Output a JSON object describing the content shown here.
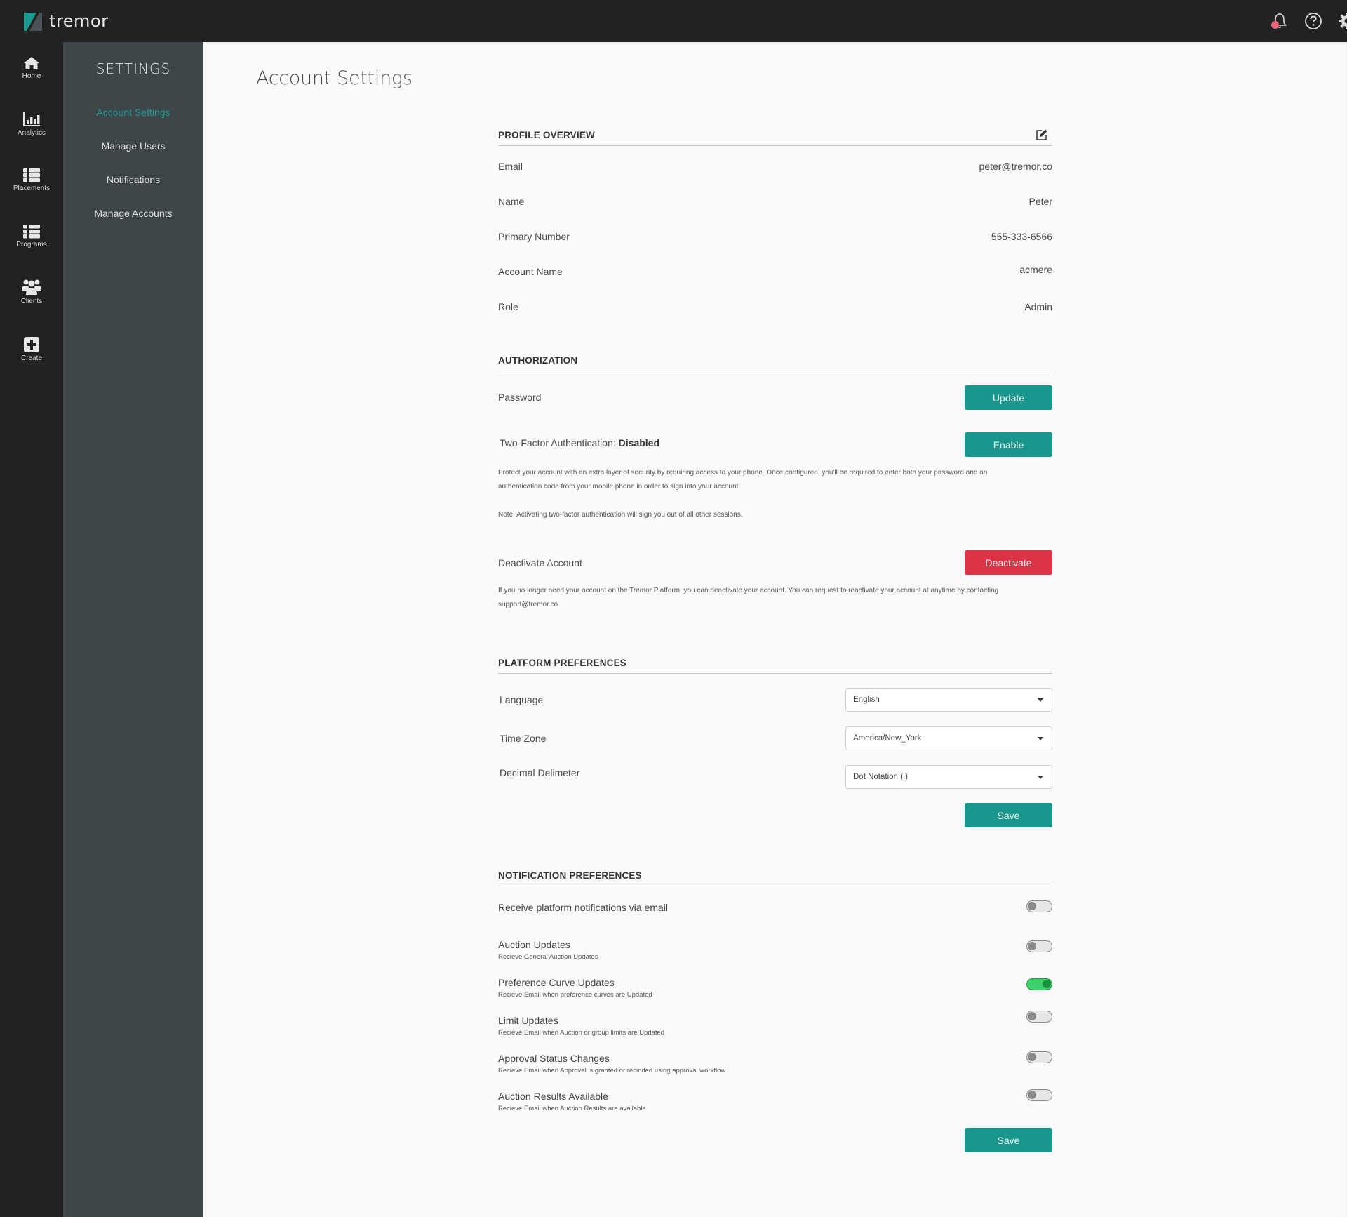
{
  "app": {
    "brand": "tremor",
    "brand_colors": {
      "accent": "#19978c",
      "danger": "#dc3446",
      "topbar": "#222222",
      "subnav": "#3e4649",
      "toggle_on": "#3ed06a"
    }
  },
  "topbar": {
    "icons": [
      {
        "name": "bell-icon",
        "has_badge": true
      },
      {
        "name": "help-icon"
      },
      {
        "name": "gear-icon"
      }
    ]
  },
  "rail": {
    "items": [
      {
        "label": "Home",
        "icon": "home-icon"
      },
      {
        "label": "Analytics",
        "icon": "bar-chart-icon"
      },
      {
        "label": "Placements",
        "icon": "list-icon"
      },
      {
        "label": "Programs",
        "icon": "list-icon"
      },
      {
        "label": "Clients",
        "icon": "users-icon"
      },
      {
        "label": "Create",
        "icon": "plus-square-icon"
      }
    ]
  },
  "subnav": {
    "title": "SETTINGS",
    "items": [
      {
        "label": "Account Settings",
        "active": true
      },
      {
        "label": "Manage Users",
        "active": false
      },
      {
        "label": "Notifications",
        "active": false
      },
      {
        "label": "Manage Accounts",
        "active": false
      }
    ]
  },
  "page": {
    "title": "Account Settings"
  },
  "profile": {
    "heading": "PROFILE OVERVIEW",
    "edit_icon": "edit-icon",
    "rows": [
      {
        "label": "Email",
        "value": "peter@tremor.co"
      },
      {
        "label": "Name",
        "value": "Peter"
      },
      {
        "label": "Primary Number",
        "value": "555-333-6566"
      },
      {
        "label": "Account Name",
        "value": "acmere"
      },
      {
        "label": "Role",
        "value": "Admin"
      }
    ]
  },
  "authorization": {
    "heading": "AUTHORIZATION",
    "password_label": "Password",
    "password_button": "Update",
    "twofa_label": "Two-Factor Authentication:",
    "twofa_status": "Disabled",
    "twofa_button": "Enable",
    "twofa_description_1": "Protect your account with an extra layer of security by requiring access to your phone. Once configured, you'll be required to enter both your password and an",
    "twofa_description_2": "authentication code from your mobile phone in order to sign into your account.",
    "twofa_note": "Note: Activating two-factor authentication will sign you out of all other sessions.",
    "deactivate_label": "Deactivate Account",
    "deactivate_button": "Deactivate",
    "deactivate_description_1": "If you no longer need your account on the Tremor Platform, you can deactivate your account. You can request to reactivate your account at anytime by contacting",
    "deactivate_description_2": "support@tremor.co"
  },
  "platform": {
    "heading": "PLATFORM PREFERENCES",
    "fields": [
      {
        "label": "Language",
        "value": "English"
      },
      {
        "label": "Time Zone",
        "value": "America/New_York"
      },
      {
        "label": "Decimal Delimeter",
        "value": "Dot Notation (.)"
      }
    ],
    "save_button": "Save"
  },
  "notifications": {
    "heading": "NOTIFICATION PREFERENCES",
    "master": {
      "label": "Receive platform notifications via email",
      "enabled": false
    },
    "items": [
      {
        "title": "Auction Updates",
        "subtitle": "Recieve General Auction Updates",
        "enabled": false
      },
      {
        "title": "Preference Curve Updates",
        "subtitle": "Recieve Email when preference curves are  Updated",
        "enabled": true
      },
      {
        "title": "Limit Updates",
        "subtitle": "Recieve Email when Auction or group limits are Updated",
        "enabled": false
      },
      {
        "title": "Approval Status Changes",
        "subtitle": "Recieve Email when Approval is granted or recinded using approval workflow",
        "enabled": false
      },
      {
        "title": "Auction Results Available",
        "subtitle": "Recieve Email when Auction Results are available",
        "enabled": false
      }
    ],
    "save_button": "Save"
  }
}
